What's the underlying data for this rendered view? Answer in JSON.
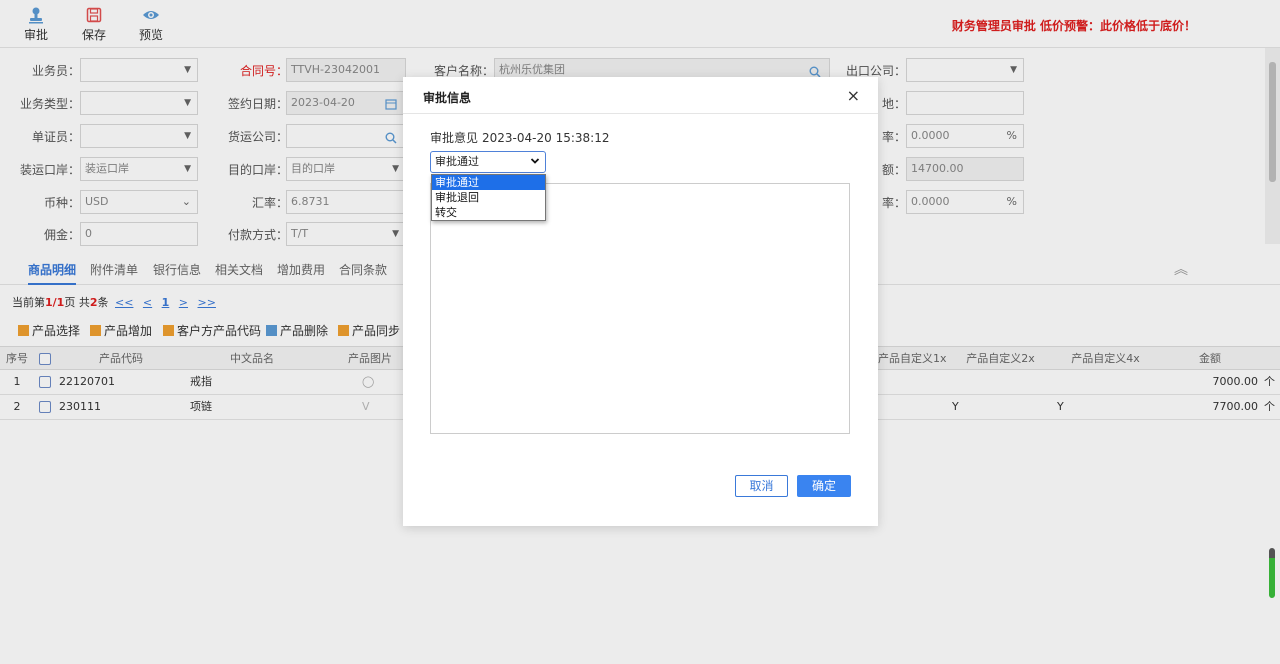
{
  "toolbar": {
    "approve": "审批",
    "save": "保存",
    "preview": "预览",
    "alert": "财务管理员审批  低价预警：此价格低于底价！"
  },
  "form": {
    "salesman": "业务员：",
    "contract_no_label": "合同号：",
    "contract_no": "TTVH-23042001",
    "customer_label": "客户名称：",
    "customer": "杭州乐优集团",
    "export_company": "出口公司：",
    "business_type": "业务类型：",
    "sign_date_label": "签约日期：",
    "sign_date": "2023-04-20",
    "origin_suffix": "地：",
    "doc_officer": "单证员：",
    "forwarder": "货运公司：",
    "rate_suffix": "率：",
    "rate_value": "0.0000",
    "pct": "%",
    "port_load_label": "装运口岸：",
    "port_load": "装运口岸",
    "dest_port_label": "目的口岸：",
    "dest_port": "目的口岸",
    "amount_suffix": "额：",
    "amount_value": "14700.00",
    "currency_label": "币种：",
    "currency": "USD",
    "exrate_label": "汇率：",
    "exrate": "6.8731",
    "ratio_suffix": "率：",
    "ratio_value": "0.0000",
    "commission_label": "佣金：",
    "commission": "0",
    "payment_label": "付款方式：",
    "payment": "T/T"
  },
  "tabs": [
    "商品明细",
    "附件清单",
    "银行信息",
    "相关文档",
    "增加费用",
    "合同条款"
  ],
  "pager": {
    "prefix": "当前第",
    "page": "1/1",
    "mid": "页 共",
    "total": "2",
    "suffix": "条",
    "first": "<<",
    "prev": "<",
    "current": "1",
    "next": ">",
    "last": ">>"
  },
  "actions": [
    "产品选择",
    "产品增加",
    "客户方产品代码",
    "产品删除",
    "产品同步"
  ],
  "table": {
    "headers": [
      "序号",
      "产品代码",
      "中文品名",
      "产品图片",
      "产品自定义1x",
      "产品自定义2x",
      "产品自定义4x",
      "金额"
    ],
    "rows": [
      {
        "no": "1",
        "code": "22120701",
        "name": "戒指",
        "c2": "",
        "c4": "",
        "amount": "7000.00",
        "unit": "个"
      },
      {
        "no": "2",
        "code": "230111",
        "name": "项链",
        "c2": "Y",
        "c4": "Y",
        "amount": "7700.00",
        "unit": "个"
      }
    ]
  },
  "dialog": {
    "title": "审批信息",
    "close": "×",
    "opinion_label": "审批意见",
    "timestamp": "2023-04-20 15:38:12",
    "selected": "审批通过",
    "options": [
      "审批通过",
      "审批退回",
      "转交"
    ],
    "cancel": "取消",
    "ok": "确定"
  }
}
